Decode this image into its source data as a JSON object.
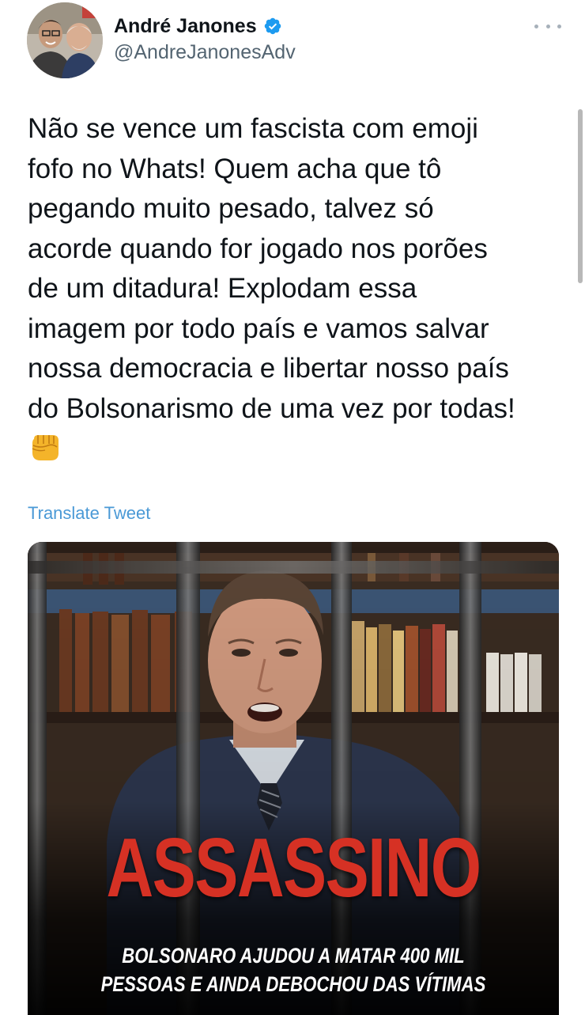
{
  "author": {
    "display_name": "André Janones",
    "handle": "@AndreJanonesAdv",
    "verified": true
  },
  "tweet": {
    "text": "Não se vence um fascista com emoji\nfofo no Whats! Quem acha que tô\npegando muito pesado, talvez só\nacorde quando for jogado nos porões\nde um ditadura! Explodam essa\nimagem por todo país e vamos salvar\nnossa democracia e libertar nosso país\ndo Bolsonarismo de uma vez por todas!",
    "emoji": "oncoming-fist",
    "translate_label": "Translate Tweet"
  },
  "media": {
    "headline": "ASSASSINO",
    "subline_1": "BOLSONARO AJUDOU A MATAR 400 MIL",
    "subline_2": "PESSOAS E AINDA DEBOCHOU DAS VÍTIMAS"
  },
  "colors": {
    "verified_badge": "#1d9bf0",
    "link": "#4a99d6",
    "secondary_text": "#536471",
    "headline_red": "#d63124"
  },
  "icons": [
    "verified-badge-icon",
    "more-options-icon",
    "fist-emoji-icon"
  ]
}
